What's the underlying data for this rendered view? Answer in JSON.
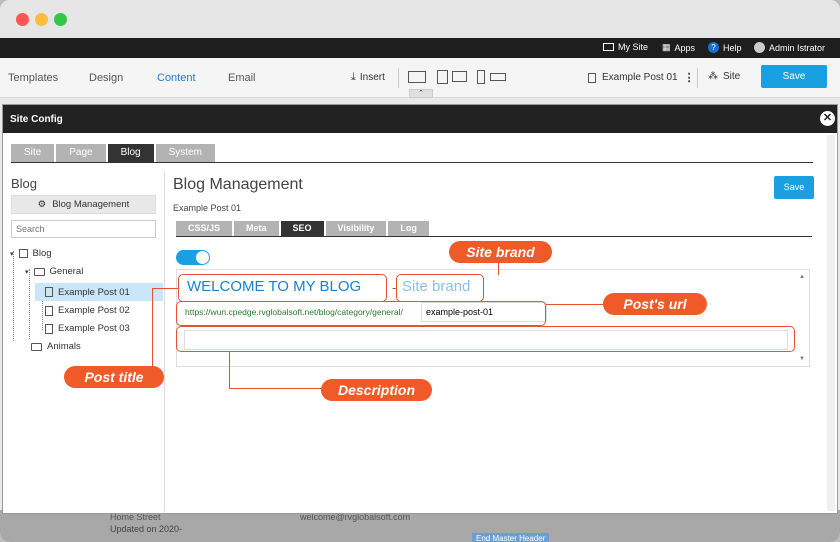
{
  "topbar": {
    "my_site": "My Site",
    "apps": "Apps",
    "help": "Help",
    "user": "Admin Istrator"
  },
  "mainbar": {
    "nav": [
      "Templates",
      "Design",
      "Content",
      "Email"
    ],
    "active_nav": "Content",
    "insert": "Insert",
    "page": "Example Post 01",
    "site": "Site",
    "save": "Save"
  },
  "modal": {
    "title": "Site Config",
    "tabs": [
      "Site",
      "Page",
      "Blog",
      "System"
    ],
    "active_tab": "Blog"
  },
  "sidebar": {
    "heading": "Blog",
    "management_button": "Blog Management",
    "search_placeholder": "Search",
    "tree": {
      "root": "Blog",
      "general": "General",
      "posts": [
        "Example Post 01",
        "Example Post 02",
        "Example Post 03"
      ],
      "animals": "Animals"
    }
  },
  "content": {
    "title": "Blog Management",
    "subtitle": "Example Post 01",
    "save": "Save",
    "seo_tabs": [
      "CSS/JS",
      "Meta",
      "SEO",
      "Visibility",
      "Log"
    ],
    "active_seo_tab": "SEO",
    "preview_title": "WELCOME TO MY BLOG",
    "separator": "-",
    "site_brand": "Site brand",
    "url_base": "https://wun.cpedge.rvglobalsoft.net/blog/category/general/",
    "slug": "example-post-01",
    "description": ""
  },
  "callouts": {
    "site_brand": "Site brand",
    "post_url": "Post's url",
    "post_title": "Post title",
    "description": "Description"
  },
  "background": {
    "street": "Home Street",
    "updated": "Updated on 2020-",
    "email": "welcome@rvglobalsoft.com",
    "footer_button": "End Master Header"
  },
  "colors": {
    "accent": "#1a9fe0",
    "callout": "#f05a28",
    "toggle": "#1a9fe0"
  }
}
